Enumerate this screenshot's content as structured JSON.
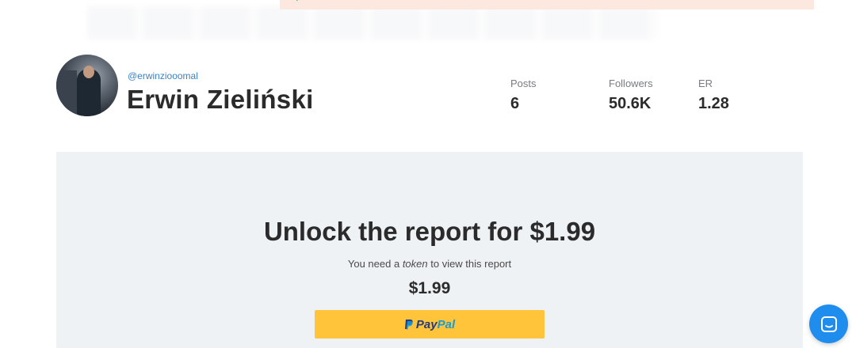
{
  "profile": {
    "username": "@erwinziooomal",
    "name": "Erwin Zieliński"
  },
  "stats": [
    {
      "label": "Posts",
      "value": "6"
    },
    {
      "label": "Followers",
      "value": "50.6K"
    },
    {
      "label": "ER",
      "value": "1.28"
    }
  ],
  "unlock": {
    "title": "Unlock the report for $1.99",
    "need_prefix": "You need a ",
    "need_token": "token",
    "need_suffix": " to view this report",
    "price": "$1.99",
    "paypal_pay": "Pay",
    "paypal_pal": "Pal"
  },
  "icons": {
    "chat": "chat-icon",
    "paypal": "paypal-logo-icon",
    "alert": "check-icon"
  },
  "colors": {
    "accent": "#3b82c4",
    "paypal_yellow": "#ffc439",
    "chat_blue": "#1f8ded",
    "panel_bg": "#eff2f5",
    "alert_bg": "#fde8df"
  }
}
